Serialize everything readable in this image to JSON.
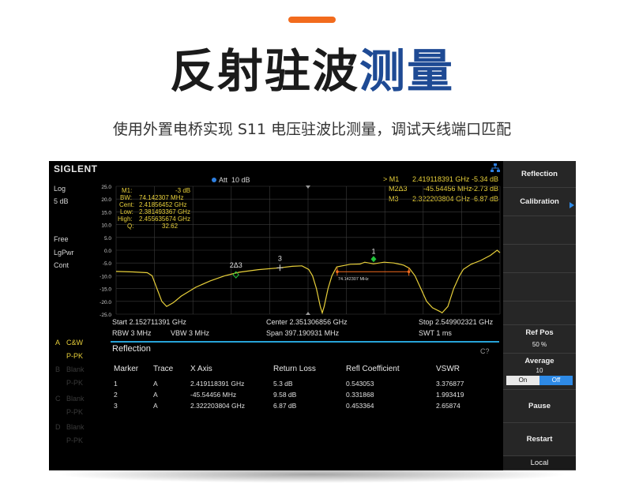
{
  "header": {
    "title_main": "反射驻波",
    "title_highlight": "测量",
    "subtitle": "使用外置电桥实现 S11 电压驻波比测量，调试天线端口匹配"
  },
  "colors": {
    "accent": "#f26b1d",
    "title_highlight": "#1e4a94",
    "trace": "#e8d03a",
    "marker": "#21c43a",
    "cyan": "#27a3d8"
  },
  "screen": {
    "logo": "SIGLENT",
    "left_labels": {
      "ref": "Log",
      "scale": "5 dB",
      "trigger": "Free",
      "detector": "LgPwr",
      "mode": "Cont"
    },
    "att": {
      "label": "Att",
      "value": "10 dB"
    },
    "traces": [
      {
        "letter": "A",
        "name": "C&W",
        "detector": "P-PK",
        "active": true
      },
      {
        "letter": "B",
        "name": "Blank",
        "detector": "P-PK",
        "active": false
      },
      {
        "letter": "C",
        "name": "Blank",
        "detector": "P-PK",
        "active": false
      },
      {
        "letter": "D",
        "name": "Blank",
        "detector": "P-PK",
        "active": false
      }
    ],
    "measure_box": [
      {
        "k": "M1:",
        "v": "-3  dB"
      },
      {
        "k": "BW:",
        "v": "74.142307  MHz"
      },
      {
        "k": "Cent:",
        "v": "2.41856452  GHz"
      },
      {
        "k": "Low:",
        "v": "2.381493367  GHz"
      },
      {
        "k": "High:",
        "v": "2.455635674  GHz"
      },
      {
        "k": "Q:",
        "v": "32.62"
      }
    ],
    "marker_table": [
      {
        "name": "> M1",
        "freq": "2.419118391 GHz",
        "value": "-5.34 dB"
      },
      {
        "name": "M2Δ3",
        "freq": "-45.54456 MHz",
        "value": "-2.73 dB"
      },
      {
        "name": "M3",
        "freq": "2.322203804 GHz",
        "value": "-6.87 dB"
      }
    ],
    "bw_annotation": "74.142307 MHz",
    "marker_labels": {
      "m1": "1",
      "m2": "2Δ3",
      "m3": "3"
    },
    "freq_info": {
      "start": "Start  2.152711391 GHz",
      "center": "Center  2.351306856 GHz",
      "stop": "Stop  2.549902321 GHz",
      "rbw": "RBW  3 MHz",
      "vbw": "VBW  3 MHz",
      "span": "Span    397.190931 MHz",
      "swt": "SWT  1 ms"
    },
    "reflection": {
      "title": "Reflection",
      "corner": "C?",
      "columns": [
        "Marker",
        "Trace",
        "X Axis",
        "Return Loss",
        "Refl Coefficient",
        "VSWR"
      ],
      "rows": [
        [
          "1",
          "A",
          "2.419118391 GHz",
          "5.3 dB",
          "0.543053",
          "3.376877"
        ],
        [
          "2",
          "A",
          "-45.54456 MHz",
          "9.58 dB",
          "0.331868",
          "1.993419"
        ],
        [
          "3",
          "A",
          "2.322203804 GHz",
          "6.87 dB",
          "0.453364",
          "2.65874"
        ]
      ]
    },
    "softkeys": {
      "reflection": "Reflection",
      "calibration": "Calibration",
      "ref_pos_label": "Ref Pos",
      "ref_pos_value": "50 %",
      "average_label": "Average",
      "average_value": "10",
      "on": "On",
      "off": "Off",
      "pause": "Pause",
      "restart": "Restart",
      "local": "Local"
    }
  },
  "chart_data": {
    "type": "line",
    "ylim": [
      -25,
      25
    ],
    "yticks": [
      "25.0",
      "20.0",
      "15.0",
      "10.0",
      "5.0",
      "0.0",
      "-5.0",
      "-10.0",
      "-15.0",
      "-20.0",
      "-25.0"
    ],
    "xlim": [
      2.152711391,
      2.549902321
    ],
    "x_unit": "GHz",
    "grid": true,
    "series": [
      {
        "points": [
          [
            2.1527,
            -8.3
          ],
          [
            2.17,
            -8.5
          ],
          [
            2.185,
            -8.8
          ],
          [
            2.19,
            -10
          ],
          [
            2.195,
            -15
          ],
          [
            2.2,
            -20
          ],
          [
            2.205,
            -22
          ],
          [
            2.212,
            -20.5
          ],
          [
            2.22,
            -18
          ],
          [
            2.235,
            -14.5
          ],
          [
            2.25,
            -12
          ],
          [
            2.265,
            -10
          ],
          [
            2.28,
            -8.6
          ],
          [
            2.3,
            -7.6
          ],
          [
            2.322,
            -6.87
          ],
          [
            2.335,
            -6.3
          ],
          [
            2.345,
            -6.1
          ],
          [
            2.352,
            -7.5
          ],
          [
            2.356,
            -10
          ],
          [
            2.36,
            -15
          ],
          [
            2.364,
            -22
          ],
          [
            2.366,
            -24.5
          ],
          [
            2.368,
            -22
          ],
          [
            2.372,
            -15
          ],
          [
            2.376,
            -10
          ],
          [
            2.381,
            -6.5
          ],
          [
            2.395,
            -5.5
          ],
          [
            2.405,
            -5.4
          ],
          [
            2.41,
            -4.7
          ],
          [
            2.419,
            -5.34
          ],
          [
            2.43,
            -4.7
          ],
          [
            2.44,
            -5.0
          ],
          [
            2.45,
            -5.8
          ],
          [
            2.456,
            -7.0
          ],
          [
            2.462,
            -10
          ],
          [
            2.468,
            -15
          ],
          [
            2.474,
            -20
          ],
          [
            2.48,
            -22.5
          ],
          [
            2.488,
            -24
          ],
          [
            2.49,
            -24.5
          ],
          [
            2.496,
            -22
          ],
          [
            2.502,
            -15
          ],
          [
            2.508,
            -10
          ],
          [
            2.512,
            -7.5
          ],
          [
            2.52,
            -5.5
          ],
          [
            2.53,
            -4
          ],
          [
            2.54,
            -2
          ],
          [
            2.547,
            0
          ],
          [
            2.5499,
            -1
          ]
        ]
      }
    ],
    "markers": [
      {
        "label": "1",
        "x": 2.419118391,
        "y": -5.34
      },
      {
        "label": "2Δ3",
        "x": 2.2767,
        "y": -9.6
      },
      {
        "label": "3",
        "x": 2.322203804,
        "y": -6.87
      }
    ],
    "bw_span": [
      2.381493367,
      2.455635674
    ],
    "bw_level": -8.4
  }
}
